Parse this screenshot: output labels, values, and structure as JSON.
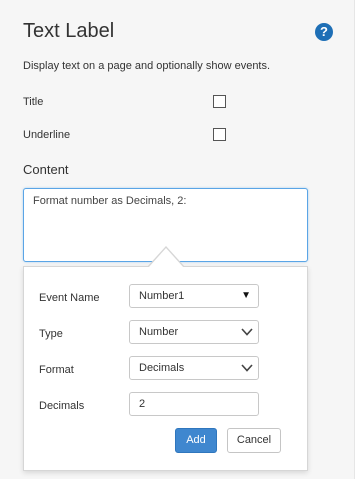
{
  "header": {
    "title": "Text Label",
    "help_icon": "question-circle-icon",
    "description": "Display text on a page and optionally show events."
  },
  "options": {
    "title_label": "Title",
    "title_checked": false,
    "underline_label": "Underline",
    "underline_checked": false
  },
  "content": {
    "label": "Content",
    "value": "Format number as Decimals, 2:"
  },
  "event_popup": {
    "event_name": {
      "label": "Event Name",
      "value": "Number1"
    },
    "type": {
      "label": "Type",
      "value": "Number"
    },
    "format": {
      "label": "Format",
      "value": "Decimals"
    },
    "decimals": {
      "label": "Decimals",
      "value": "2"
    },
    "add_label": "Add",
    "cancel_label": "Cancel"
  },
  "colors": {
    "accent": "#3f87cf",
    "help_icon": "#1e6fb6",
    "focus_border": "#5aa5e6"
  }
}
